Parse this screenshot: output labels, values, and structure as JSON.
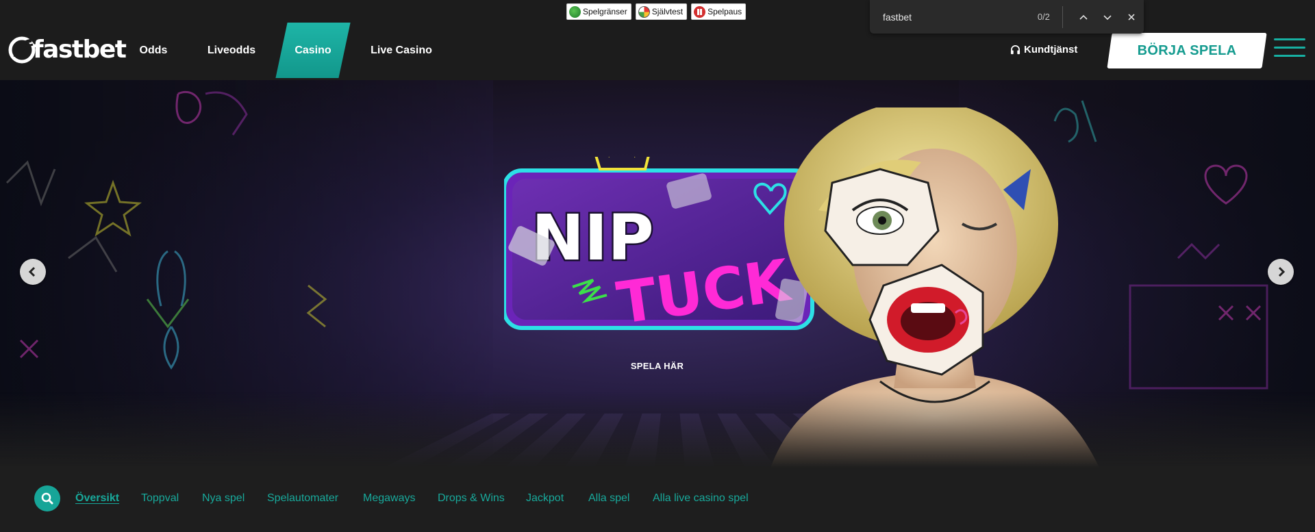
{
  "responsible_gaming": {
    "badges": [
      {
        "label": "Spelgränser",
        "icon": "limit-icon",
        "color": "#2e9c3f"
      },
      {
        "label": "Självtest",
        "icon": "gauge-icon",
        "color": "#fbc02d"
      },
      {
        "label": "Spelpaus",
        "icon": "pause-icon",
        "color": "#d32f2f"
      }
    ]
  },
  "find_bar": {
    "query": "fastbet",
    "count": "0/2",
    "icons": [
      "chevron-up-icon",
      "chevron-down-icon",
      "close-icon"
    ]
  },
  "header": {
    "logo_text": "fastbet",
    "nav": [
      {
        "label": "Odds",
        "active": false
      },
      {
        "label": "Liveodds",
        "active": false
      },
      {
        "label": "Casino",
        "active": true
      },
      {
        "label": "Live Casino",
        "active": false
      }
    ],
    "support_label": "Kundtjänst",
    "cta_label": "BÖRJA SPELA",
    "menu_icon": "hamburger-icon"
  },
  "hero": {
    "game_title_line1": "NIP",
    "game_title_line2": "TUCK",
    "cta_label": "SPELA HÄR",
    "prev_icon": "chevron-left-icon",
    "next_icon": "chevron-right-icon"
  },
  "categories": {
    "search_icon": "search-icon",
    "items": [
      {
        "label": "Översikt",
        "active": true
      },
      {
        "label": "Toppval",
        "active": false
      },
      {
        "label": "Nya spel",
        "active": false
      },
      {
        "label": "Spelautomater",
        "active": false
      },
      {
        "label": "Megaways",
        "active": false
      },
      {
        "label": "Drops & Wins",
        "active": false
      },
      {
        "label": "Jackpot",
        "active": false
      },
      {
        "label": "Alla spel",
        "active": false
      },
      {
        "label": "Alla live casino spel",
        "active": false
      }
    ]
  },
  "colors": {
    "accent": "#17a598",
    "background": "#1e1e1e",
    "cta_background": "#ffffff"
  }
}
